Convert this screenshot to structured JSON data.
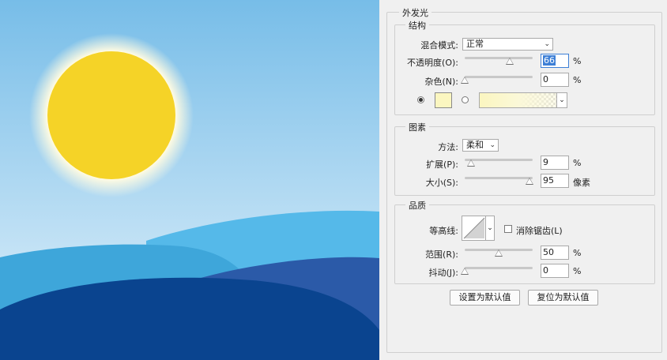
{
  "dialog": {
    "section_title": "外发光",
    "structure": {
      "title": "结构",
      "blend_mode_label": "混合模式:",
      "blend_mode_value": "正常",
      "opacity_label": "不透明度(O):",
      "opacity_value": "66",
      "opacity_unit": "%",
      "opacity_level": 66,
      "noise_label": "杂色(N):",
      "noise_value": "0",
      "noise_unit": "%",
      "noise_level": 0,
      "glow_color": "#fbf6c0",
      "radio_color_selected": true
    },
    "elements": {
      "title": "图素",
      "technique_label": "方法:",
      "technique_value": "柔和",
      "spread_label": "扩展(P):",
      "spread_value": "9",
      "spread_unit": "%",
      "spread_level": 9,
      "size_label": "大小(S):",
      "size_value": "95",
      "size_unit": "像素",
      "size_level": 95
    },
    "quality": {
      "title": "品质",
      "contour_label": "等高线:",
      "antialias_label": "消除锯齿(L)",
      "antialias_checked": false,
      "range_label": "范围(R):",
      "range_value": "50",
      "range_unit": "%",
      "range_level": 50,
      "jitter_label": "抖动(J):",
      "jitter_value": "0",
      "jitter_unit": "%",
      "jitter_level": 0
    },
    "buttons": {
      "set_default": "设置为默认值",
      "reset_default": "复位为默认值"
    }
  },
  "scene": {
    "sky_top": "#77bde8",
    "sky_bottom": "#e4f2fb",
    "sun_color": "#f5d327",
    "hill_light": "#55b9e9",
    "hill_mid": "#3ea6da",
    "hill_dark": "#2b5aa8",
    "hill_front": "#0a448f"
  }
}
